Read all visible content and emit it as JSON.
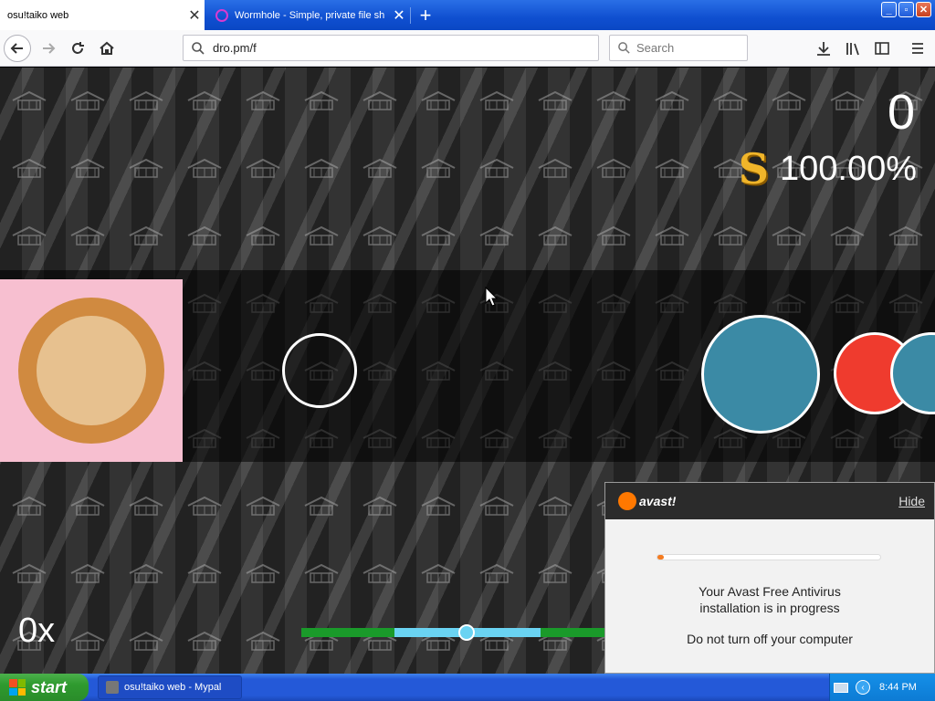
{
  "browser": {
    "tabs": [
      {
        "title": "osu!taiko web",
        "active": true
      },
      {
        "title": "Wormhole - Simple, private file sh",
        "active": false
      }
    ],
    "url": "dro.pm/f",
    "search_placeholder": "Search",
    "window_buttons": [
      "minimize",
      "restore",
      "close"
    ]
  },
  "game": {
    "score": "0",
    "rank": "S",
    "accuracy": "100.00%",
    "combo": "0x",
    "progress": 0.52,
    "colors": {
      "don_red": "#ef3b2e",
      "kat_blue": "#3b8aa5",
      "drum_outer": "#d08a40",
      "drum_inner": "#e7c18f",
      "panel_pink": "#f7bfd0"
    }
  },
  "avast": {
    "logo_text": "avast!",
    "hide_label": "Hide",
    "message_line1": "Your Avast Free Antivirus",
    "message_line2": "installation is in progress",
    "warning": "Do not turn off your computer",
    "progress": 0.03
  },
  "taskbar": {
    "start_label": "start",
    "task_item": "osu!taiko web - Mypal",
    "clock": "8:44 PM"
  }
}
